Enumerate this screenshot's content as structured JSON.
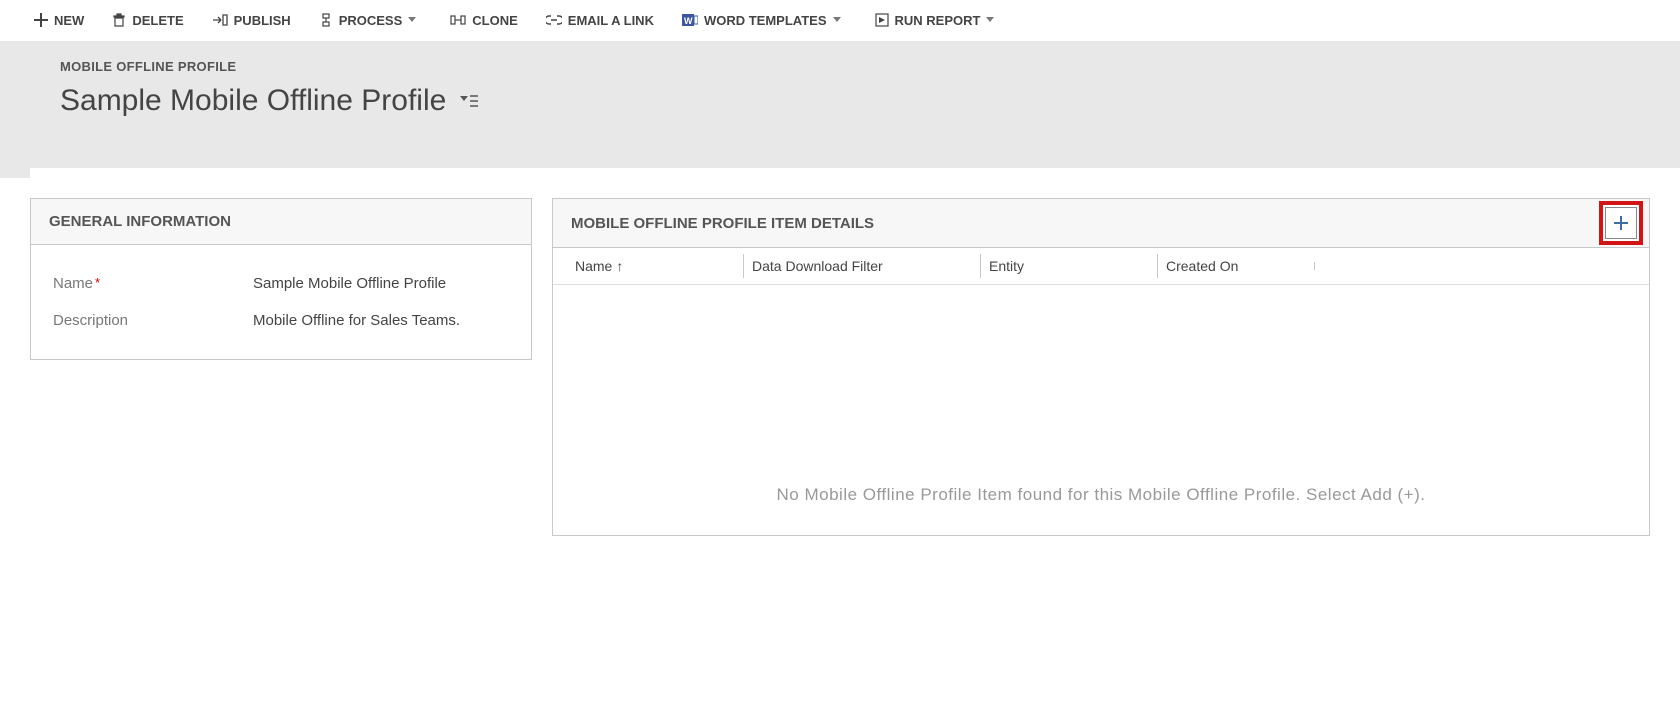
{
  "commands": {
    "new_label": "NEW",
    "delete_label": "DELETE",
    "publish_label": "PUBLISH",
    "process_label": "PROCESS",
    "clone_label": "CLONE",
    "email_link_label": "EMAIL A LINK",
    "word_templates_label": "WORD TEMPLATES",
    "run_report_label": "RUN REPORT"
  },
  "header": {
    "breadcrumb": "MOBILE OFFLINE PROFILE",
    "title": "Sample Mobile Offline Profile"
  },
  "general": {
    "section_title": "GENERAL INFORMATION",
    "name_label": "Name",
    "name_value": "Sample Mobile Offline Profile",
    "description_label": "Description",
    "description_value": "Mobile Offline for Sales Teams."
  },
  "details": {
    "section_title": "MOBILE OFFLINE PROFILE ITEM DETAILS",
    "columns": {
      "name": "Name",
      "filter": "Data Download Filter",
      "entity": "Entity",
      "created_on": "Created On"
    },
    "empty_message": "No Mobile Offline Profile Item found for this Mobile Offline Profile. Select Add (+)."
  }
}
